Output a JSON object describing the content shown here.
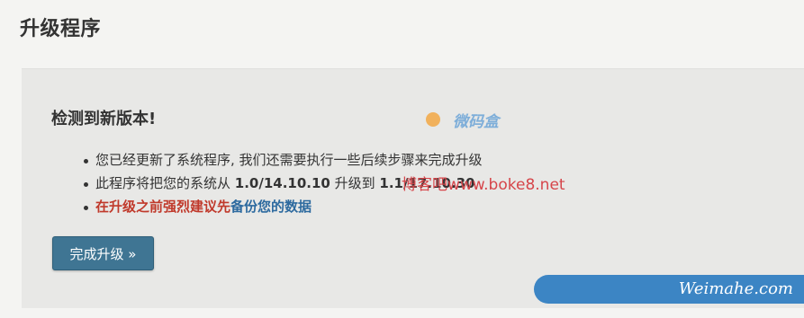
{
  "page": {
    "title": "升级程序"
  },
  "panel": {
    "heading": "检测到新版本!",
    "items": [
      {
        "text": "您已经更新了系统程序, 我们还需要执行一些后续步骤来完成升级"
      },
      {
        "prefix": "此程序将把您的系统从 ",
        "from_version": "1.0/14.10.10",
        "middle": " 升级到 ",
        "to_version": "1.1/17.10.30"
      },
      {
        "warning_red": "在升级之前强烈建议先",
        "warning_blue": "备份您的数据"
      }
    ],
    "button_label": "完成升级 »"
  },
  "watermarks": {
    "logo_text": "微码盒",
    "boke": "博客吧www.boke8.net",
    "weimahe": "Weimahe.com"
  },
  "colors": {
    "accent_button": "#3f7593",
    "warning_red": "#c0392b",
    "warning_blue": "#2d6a9f",
    "panel_bg": "#e8e8e6"
  }
}
